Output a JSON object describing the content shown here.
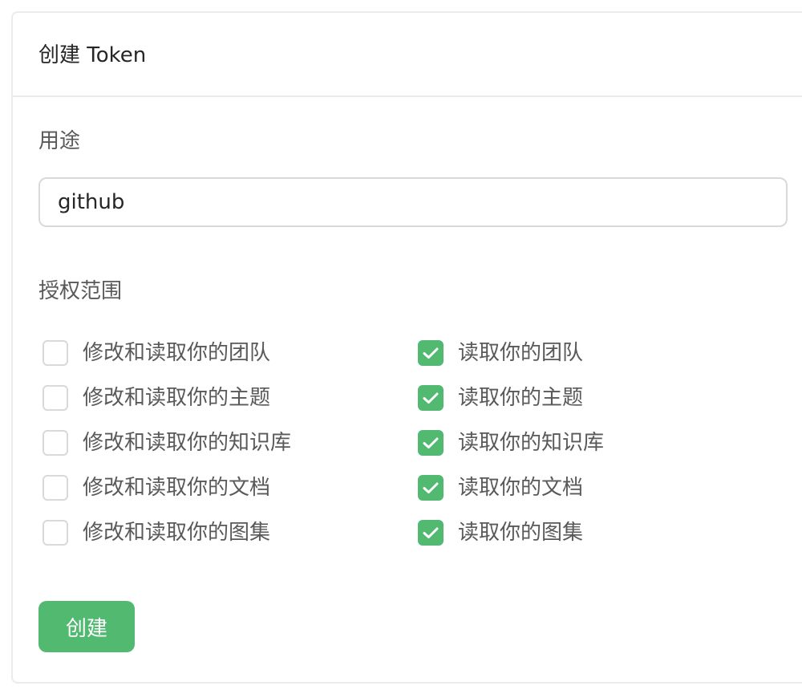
{
  "header": {
    "title": "创建 Token"
  },
  "form": {
    "purpose_label": "用途",
    "purpose_value": "github",
    "scope_label": "授权范围",
    "scopes_left": [
      {
        "label": "修改和读取你的团队",
        "checked": false
      },
      {
        "label": "修改和读取你的主题",
        "checked": false
      },
      {
        "label": "修改和读取你的知识库",
        "checked": false
      },
      {
        "label": "修改和读取你的文档",
        "checked": false
      },
      {
        "label": "修改和读取你的图集",
        "checked": false
      }
    ],
    "scopes_right": [
      {
        "label": "读取你的团队",
        "checked": true
      },
      {
        "label": "读取你的主题",
        "checked": true
      },
      {
        "label": "读取你的知识库",
        "checked": true
      },
      {
        "label": "读取你的文档",
        "checked": true
      },
      {
        "label": "读取你的图集",
        "checked": true
      }
    ],
    "submit_label": "创建"
  },
  "colors": {
    "accent": "#52b971",
    "border": "#d9d9d9",
    "text": "#595959",
    "title": "#262626"
  }
}
